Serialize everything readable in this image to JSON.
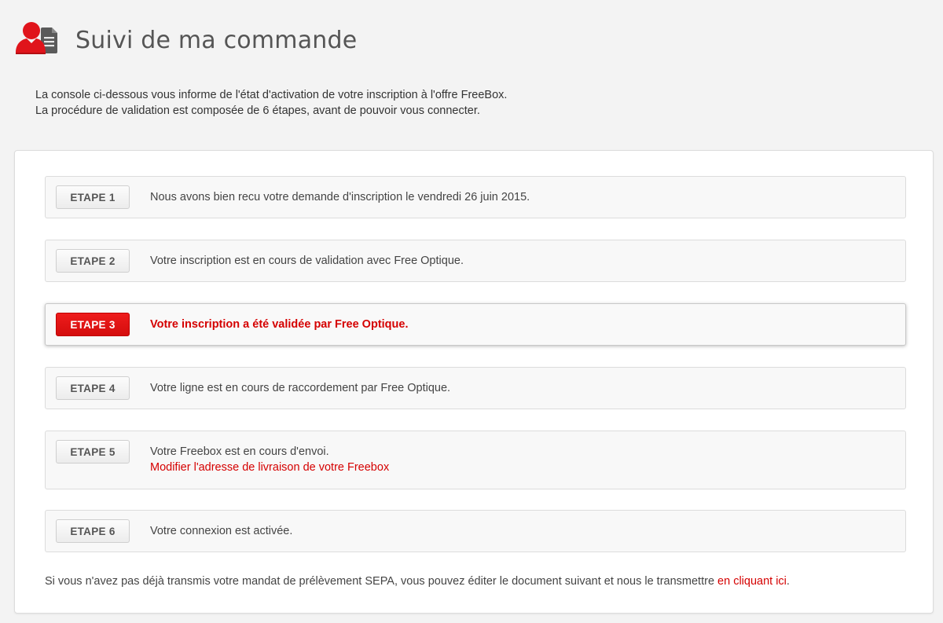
{
  "header": {
    "title": "Suivi de ma commande",
    "icon": "user-document-icon",
    "icon_colors": {
      "user": "#e0141b",
      "document": "#5a5a5a"
    }
  },
  "intro": {
    "line1": "La console ci-dessous vous informe de l'état d'activation de votre inscription à l'offre FreeBox.",
    "line2": "La procédure de validation est composée de 6 étapes, avant de pouvoir vous connecter."
  },
  "steps": [
    {
      "label": "ETAPE 1",
      "text": "Nous avons bien recu votre demande d'inscription le vendredi 26 juin 2015.",
      "active": false
    },
    {
      "label": "ETAPE 2",
      "text": "Votre inscription est en cours de validation avec Free Optique.",
      "active": false
    },
    {
      "label": "ETAPE 3",
      "text": "Votre inscription a été validée par Free Optique.",
      "active": true
    },
    {
      "label": "ETAPE 4",
      "text": "Votre ligne est en cours de raccordement par Free Optique.",
      "active": false
    },
    {
      "label": "ETAPE 5",
      "text": "Votre Freebox est en cours d'envoi.",
      "link": "Modifier l'adresse de livraison de votre Freebox",
      "active": false
    },
    {
      "label": "ETAPE 6",
      "text": "Votre connexion est activée.",
      "active": false
    }
  ],
  "footer": {
    "text": "Si vous n'avez pas déjà transmis votre mandat de prélèvement SEPA, vous pouvez éditer le document suivant et nous le transmettre ",
    "link": "en cliquant ici",
    "end": "."
  },
  "colors": {
    "accent": "#d50000",
    "active_badge": "#e41414",
    "background": "#f3f3f3"
  }
}
